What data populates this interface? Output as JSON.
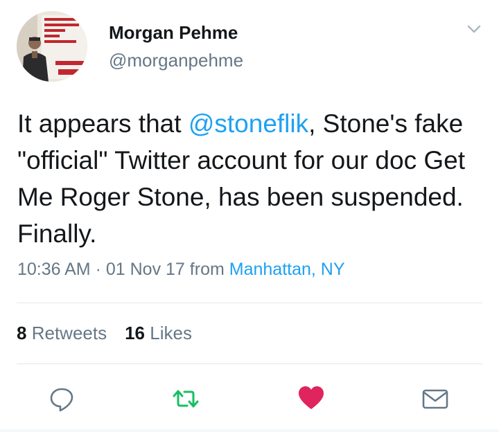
{
  "user": {
    "display_name": "Morgan Pehme",
    "handle": "@morganpehme",
    "avatar_icon": "avatar-photo"
  },
  "tweet": {
    "text_before": "It appears that ",
    "mention": "@stoneflik",
    "text_after": ", Stone's fake \"official\" Twitter account for our doc Get Me Roger Stone, has been suspended. Finally."
  },
  "meta": {
    "time": "10:36 AM",
    "separator": "·",
    "date": "01 Nov 17",
    "from_label": "from",
    "location": "Manhattan, NY"
  },
  "stats": {
    "retweets_count": "8",
    "retweets_label": "Retweets",
    "likes_count": "16",
    "likes_label": "Likes"
  },
  "actions": {
    "reply_icon": "reply-icon",
    "retweet_icon": "retweet-icon",
    "like_icon": "heart-icon",
    "dm_icon": "envelope-icon"
  },
  "colors": {
    "link": "#1da1f2",
    "secondary_text": "#657786",
    "retweet_active": "#17bf63",
    "like_active": "#e0245e",
    "divider": "#e1e8ed"
  }
}
